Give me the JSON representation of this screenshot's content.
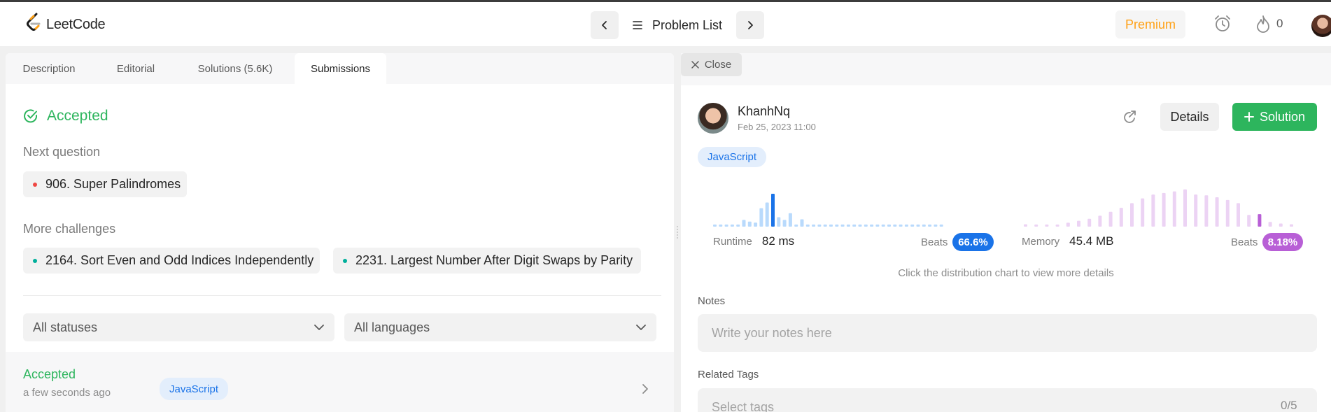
{
  "colors": {
    "accent": "#ffa116",
    "success": "#2db55d",
    "blue": "#1a73e8",
    "purple": "#b85fd6",
    "red_dot": "#ef4743",
    "teal_dot": "#00af9b"
  },
  "navbar": {
    "logo_text": "LeetCode",
    "problem_list": "Problem List",
    "premium": "Premium",
    "fire_count": "0",
    "icons": [
      "leetcode-logo-icon",
      "chevron-left-icon",
      "menu-icon",
      "chevron-right-icon",
      "alarm-clock-icon",
      "fire-icon"
    ]
  },
  "left_tabs": [
    {
      "label": "Description"
    },
    {
      "label": "Editorial"
    },
    {
      "label": "Solutions (5.6K)"
    },
    {
      "label": "Submissions",
      "active": true
    }
  ],
  "result": {
    "status": "Accepted",
    "icon": "check-circle-icon"
  },
  "next_question": {
    "label": "Next question",
    "item": {
      "title": "906. Super Palindromes",
      "difficulty": "hard"
    }
  },
  "more_challenges": {
    "label": "More challenges",
    "items": [
      {
        "title": "2164. Sort Even and Odd Indices Independently",
        "difficulty": "easy"
      },
      {
        "title": "2231. Largest Number After Digit Swaps by Parity",
        "difficulty": "easy"
      }
    ]
  },
  "filters": {
    "status": "All statuses",
    "language": "All languages"
  },
  "submission_row": {
    "status": "Accepted",
    "time": "a few seconds ago",
    "language": "JavaScript"
  },
  "right_panel": {
    "close_label": "Close",
    "user": {
      "name": "KhanhNq",
      "date": "Feb 25, 2023 11:00"
    },
    "details_label": "Details",
    "solution_label": "Solution",
    "language": "JavaScript",
    "runtime": {
      "label": "Runtime",
      "value": "82 ms",
      "beats_label": "Beats",
      "beats_value": "66.6%",
      "distribution": [
        0.05,
        0.05,
        0.05,
        0.05,
        0.05,
        0.2,
        0.15,
        0.12,
        0.55,
        0.72,
        0.98,
        0.28,
        0.2,
        0.4,
        0.06,
        0.22,
        0.05,
        0.05,
        0.05,
        0.05,
        0.05,
        0.05,
        0.05,
        0.05,
        0.05,
        0.05,
        0.05,
        0.05,
        0.05,
        0.05,
        0.05,
        0.05,
        0.05,
        0.05,
        0.05,
        0.05,
        0.05,
        0.05,
        0.05,
        0.05
      ],
      "highlight_index": 10
    },
    "memory": {
      "label": "Memory",
      "value": "45.4 MB",
      "beats_label": "Beats",
      "beats_value": "8.18%",
      "distribution": [
        0.06,
        0.05,
        0.05,
        0.05,
        0.1,
        0.15,
        0.2,
        0.28,
        0.38,
        0.48,
        0.6,
        0.72,
        0.82,
        0.86,
        0.9,
        0.95,
        0.82,
        0.8,
        0.75,
        0.68,
        0.6,
        0.3,
        0.32,
        0.12,
        0.08,
        0.06
      ],
      "highlight_index": 22
    },
    "hint": "Click the distribution chart to view more details",
    "notes_label": "Notes",
    "notes_placeholder": "Write your notes here",
    "tags_label": "Related Tags",
    "tags_placeholder": "Select tags",
    "tags_count": "0/5"
  }
}
